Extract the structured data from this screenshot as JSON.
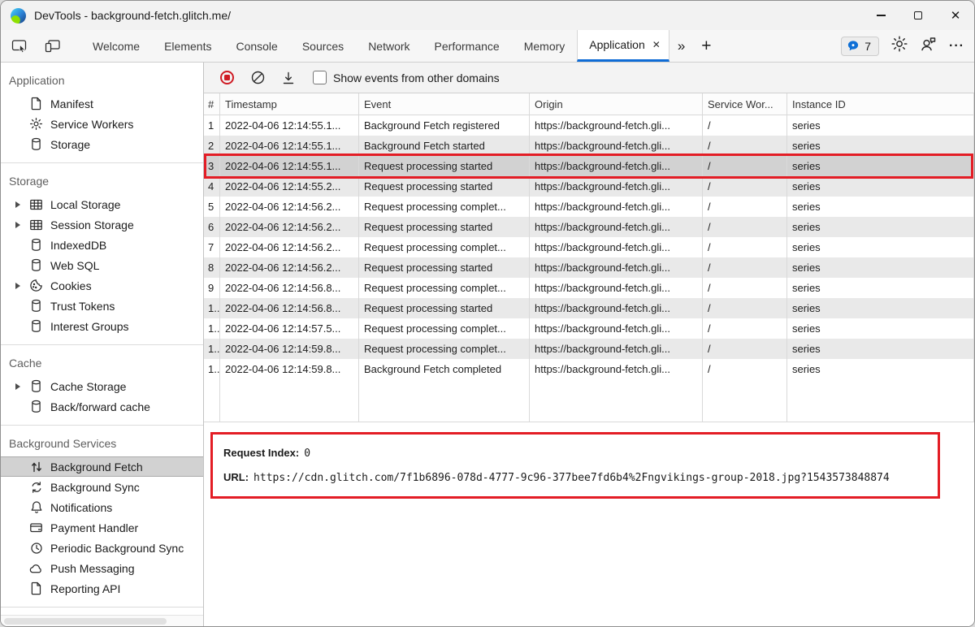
{
  "window": {
    "title": "DevTools - background-fetch.glitch.me/"
  },
  "glyphs": {
    "close_window": "✕",
    "tab_close": "✕",
    "more_tabs": "»",
    "add_tab": "+",
    "overflow_menu": "···"
  },
  "tabbar": {
    "tabs": [
      {
        "label": "Welcome"
      },
      {
        "label": "Elements"
      },
      {
        "label": "Console"
      },
      {
        "label": "Sources"
      },
      {
        "label": "Network"
      },
      {
        "label": "Performance"
      },
      {
        "label": "Memory"
      },
      {
        "label": "Application",
        "active": true
      }
    ],
    "issues_count": "7"
  },
  "sidebar": {
    "sections": [
      {
        "title": "Application",
        "items": [
          {
            "label": "Manifest",
            "icon": "file-icon"
          },
          {
            "label": "Service Workers",
            "icon": "gear-icon"
          },
          {
            "label": "Storage",
            "icon": "database-icon"
          }
        ]
      },
      {
        "title": "Storage",
        "items": [
          {
            "label": "Local Storage",
            "icon": "table-icon",
            "expandable": true
          },
          {
            "label": "Session Storage",
            "icon": "table-icon",
            "expandable": true
          },
          {
            "label": "IndexedDB",
            "icon": "database-icon"
          },
          {
            "label": "Web SQL",
            "icon": "database-icon"
          },
          {
            "label": "Cookies",
            "icon": "cookie-icon",
            "expandable": true
          },
          {
            "label": "Trust Tokens",
            "icon": "database-icon"
          },
          {
            "label": "Interest Groups",
            "icon": "database-icon"
          }
        ]
      },
      {
        "title": "Cache",
        "items": [
          {
            "label": "Cache Storage",
            "icon": "database-icon",
            "expandable": true
          },
          {
            "label": "Back/forward cache",
            "icon": "database-icon"
          }
        ]
      },
      {
        "title": "Background Services",
        "items": [
          {
            "label": "Background Fetch",
            "icon": "up-down-arrows-icon",
            "selected": true
          },
          {
            "label": "Background Sync",
            "icon": "sync-icon"
          },
          {
            "label": "Notifications",
            "icon": "bell-icon"
          },
          {
            "label": "Payment Handler",
            "icon": "card-icon"
          },
          {
            "label": "Periodic Background Sync",
            "icon": "clock-icon"
          },
          {
            "label": "Push Messaging",
            "icon": "cloud-icon"
          },
          {
            "label": "Reporting API",
            "icon": "file-icon"
          }
        ]
      }
    ]
  },
  "toolbar": {
    "checkbox_label": "Show events from other domains",
    "checkbox_checked": false
  },
  "table": {
    "columns": {
      "num": "#",
      "timestamp": "Timestamp",
      "event": "Event",
      "origin": "Origin",
      "service_worker": "Service Wor...",
      "instance_id": "Instance ID"
    },
    "rows": [
      {
        "num": "1",
        "timestamp": "2022-04-06 12:14:55.1...",
        "event": "Background Fetch registered",
        "origin": "https://background-fetch.gli...",
        "service_worker": "/",
        "instance_id": "series"
      },
      {
        "num": "2",
        "timestamp": "2022-04-06 12:14:55.1...",
        "event": "Background Fetch started",
        "origin": "https://background-fetch.gli...",
        "service_worker": "/",
        "instance_id": "series"
      },
      {
        "num": "3",
        "timestamp": "2022-04-06 12:14:55.1...",
        "event": "Request processing started",
        "origin": "https://background-fetch.gli...",
        "service_worker": "/",
        "instance_id": "series"
      },
      {
        "num": "4",
        "timestamp": "2022-04-06 12:14:55.2...",
        "event": "Request processing started",
        "origin": "https://background-fetch.gli...",
        "service_worker": "/",
        "instance_id": "series"
      },
      {
        "num": "5",
        "timestamp": "2022-04-06 12:14:56.2...",
        "event": "Request processing complet...",
        "origin": "https://background-fetch.gli...",
        "service_worker": "/",
        "instance_id": "series"
      },
      {
        "num": "6",
        "timestamp": "2022-04-06 12:14:56.2...",
        "event": "Request processing started",
        "origin": "https://background-fetch.gli...",
        "service_worker": "/",
        "instance_id": "series"
      },
      {
        "num": "7",
        "timestamp": "2022-04-06 12:14:56.2...",
        "event": "Request processing complet...",
        "origin": "https://background-fetch.gli...",
        "service_worker": "/",
        "instance_id": "series"
      },
      {
        "num": "8",
        "timestamp": "2022-04-06 12:14:56.2...",
        "event": "Request processing started",
        "origin": "https://background-fetch.gli...",
        "service_worker": "/",
        "instance_id": "series"
      },
      {
        "num": "9",
        "timestamp": "2022-04-06 12:14:56.8...",
        "event": "Request processing complet...",
        "origin": "https://background-fetch.gli...",
        "service_worker": "/",
        "instance_id": "series"
      },
      {
        "num": "1..",
        "timestamp": "2022-04-06 12:14:56.8...",
        "event": "Request processing started",
        "origin": "https://background-fetch.gli...",
        "service_worker": "/",
        "instance_id": "series"
      },
      {
        "num": "1..",
        "timestamp": "2022-04-06 12:14:57.5...",
        "event": "Request processing complet...",
        "origin": "https://background-fetch.gli...",
        "service_worker": "/",
        "instance_id": "series"
      },
      {
        "num": "1..",
        "timestamp": "2022-04-06 12:14:59.8...",
        "event": "Request processing complet...",
        "origin": "https://background-fetch.gli...",
        "service_worker": "/",
        "instance_id": "series"
      },
      {
        "num": "1..",
        "timestamp": "2022-04-06 12:14:59.8...",
        "event": "Background Fetch completed",
        "origin": "https://background-fetch.gli...",
        "service_worker": "/",
        "instance_id": "series"
      }
    ]
  },
  "details": {
    "request_index_label": "Request Index:",
    "request_index_value": "0",
    "url_label": "URL:",
    "url_value": "https://cdn.glitch.com/7f1b6896-078d-4777-9c96-377bee7fd6b4%2Fngvikings-group-2018.jpg?1543573848874"
  },
  "colors": {
    "accent_blue": "#0f6cd6",
    "annotation_red": "#e31d25",
    "issues_bubble_blue": "#0e6fd6",
    "record_red": "#cf1b24",
    "selected_row": "#d2d2d2",
    "alt_row": "#e9e9e9"
  }
}
